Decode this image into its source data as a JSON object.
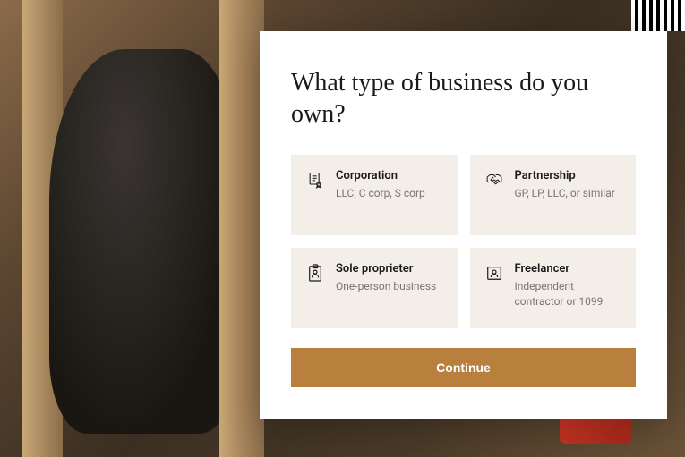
{
  "heading": "What type of business do you own?",
  "options": [
    {
      "icon": "document-badge",
      "title": "Corporation",
      "desc": "LLC, C corp, S corp"
    },
    {
      "icon": "handshake",
      "title": "Partnership",
      "desc": "GP, LP, LLC, or similar"
    },
    {
      "icon": "clipboard-person",
      "title": "Sole proprieter",
      "desc": "One-person business"
    },
    {
      "icon": "id-card",
      "title": "Freelancer",
      "desc": "Independent contractor or 1099"
    }
  ],
  "continue_label": "Continue"
}
